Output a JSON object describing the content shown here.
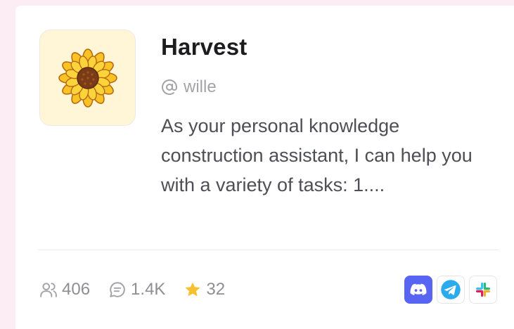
{
  "card": {
    "title": "Harvest",
    "author": "wille",
    "description": "As your personal knowledge construction assistant, I can help you with a variety of tasks: 1....",
    "avatar_icon": "sunflower-icon",
    "stats": {
      "users": "406",
      "comments": "1.4K",
      "stars": "32"
    },
    "integrations": [
      "discord-icon",
      "telegram-icon",
      "slack-icon"
    ]
  },
  "colors": {
    "background": "#fcecf4",
    "avatar_bg": "#fff6d8",
    "star": "#f5c12e",
    "discord": "#5865F2",
    "telegram": "#2AABEE"
  }
}
